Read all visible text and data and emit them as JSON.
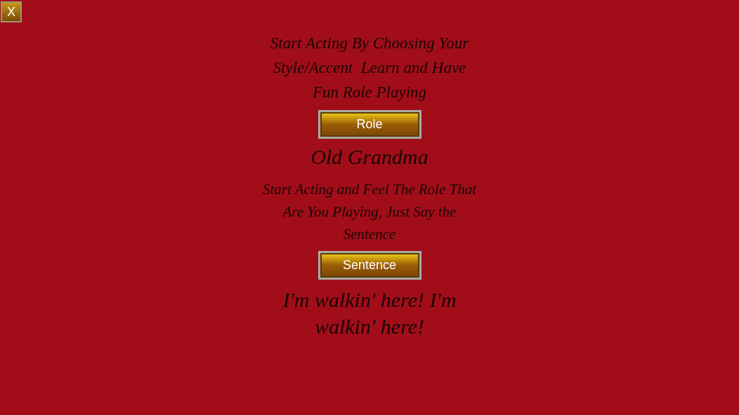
{
  "close_button": {
    "label": "X"
  },
  "intro": "Start Acting By Choosing Your Style/Accent  Learn and Have Fun Role Playing",
  "role_button": {
    "label": "Role"
  },
  "role": "Old Grandma",
  "instruction": "Start Acting and Feel The Role That Are You Playing, Just Say the Sentence",
  "sentence_button": {
    "label": "Sentence"
  },
  "sentence": "I'm walkin' here! I'm walkin' here!"
}
